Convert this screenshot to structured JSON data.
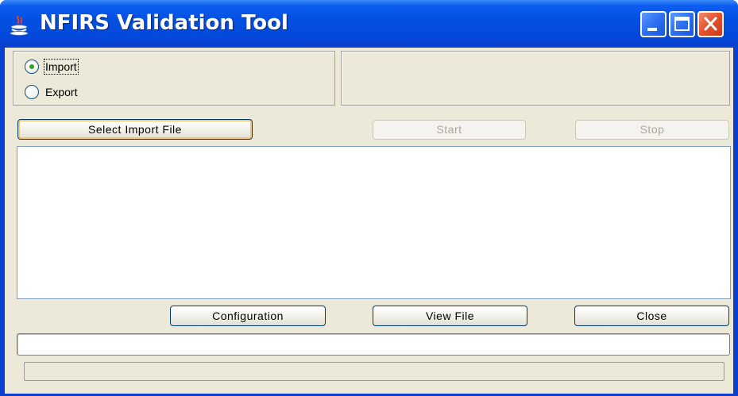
{
  "window": {
    "title": "NFIRS Validation Tool",
    "icon": "java-cup-icon",
    "controls": [
      "minimize",
      "maximize",
      "close"
    ]
  },
  "mode": {
    "options": [
      {
        "label": "Import",
        "selected": true
      },
      {
        "label": "Export",
        "selected": false
      }
    ]
  },
  "buttons": {
    "select_file": "Select Import File",
    "start": "Start",
    "stop": "Stop",
    "configuration": "Configuration",
    "view_file": "View File",
    "close": "Close"
  },
  "status": {
    "text_value": "",
    "progress": 0
  },
  "colors": {
    "titlebar": "#0450e2",
    "client_bg": "#ece9d8",
    "close_button": "#e2512c"
  }
}
